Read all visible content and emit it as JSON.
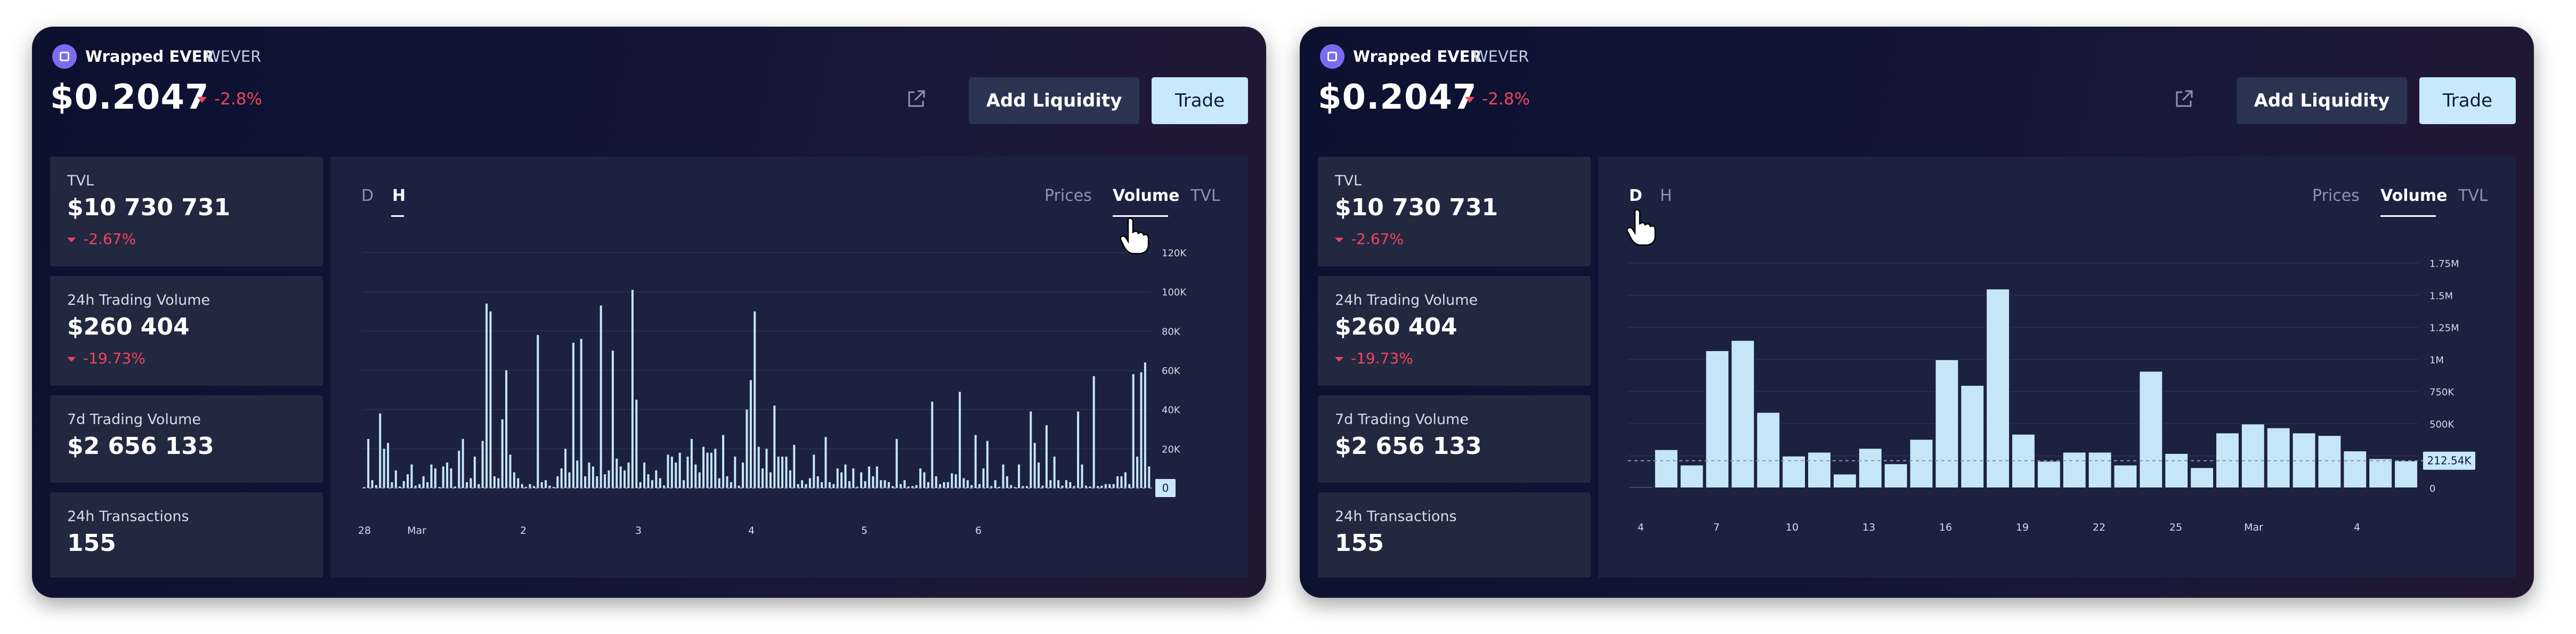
{
  "colors": {
    "panel_bg": "#0f1234",
    "card_bg": "#222840",
    "chart_bg": "#1c2140",
    "negative": "#f0435c",
    "bar_fill": "#c5e6f7",
    "trade_button": "#c8e8fb",
    "liquidity_button": "#2a3350"
  },
  "panels": [
    {
      "token": {
        "name": "Wrapped EVER",
        "symbol": "WEVER"
      },
      "price": "$0.2047",
      "price_change": "-2.8%",
      "buttons": {
        "add_liquidity": "Add Liquidity",
        "trade": "Trade"
      },
      "stats": [
        {
          "label": "TVL",
          "value": "$10 730 731",
          "change": "-2.67%"
        },
        {
          "label": "24h Trading Volume",
          "value": "$260 404",
          "change": "-19.73%"
        },
        {
          "label": "7d Trading Volume",
          "value": "$2 656 133",
          "change": ""
        },
        {
          "label": "24h Transactions",
          "value": "155",
          "change": ""
        }
      ],
      "period_tabs": [
        "D",
        "H"
      ],
      "active_period": "H",
      "metric_tabs": [
        "Prices",
        "Volume",
        "TVL"
      ],
      "active_metric": "Volume"
    },
    {
      "token": {
        "name": "Wrapped EVER",
        "symbol": "WEVER"
      },
      "price": "$0.2047",
      "price_change": "-2.8%",
      "buttons": {
        "add_liquidity": "Add Liquidity",
        "trade": "Trade"
      },
      "stats": [
        {
          "label": "TVL",
          "value": "$10 730 731",
          "change": "-2.67%"
        },
        {
          "label": "24h Trading Volume",
          "value": "$260 404",
          "change": "-19.73%"
        },
        {
          "label": "7d Trading Volume",
          "value": "$2 656 133",
          "change": ""
        },
        {
          "label": "24h Transactions",
          "value": "155",
          "change": ""
        }
      ],
      "period_tabs": [
        "D",
        "H"
      ],
      "active_period": "D",
      "metric_tabs": [
        "Prices",
        "Volume",
        "TVL"
      ],
      "active_metric": "Volume"
    }
  ],
  "chart_data": [
    {
      "type": "bar",
      "ylim": [
        0,
        120000
      ],
      "y_ticks": [
        0,
        20000,
        40000,
        60000,
        80000,
        100000,
        120000
      ],
      "y_tick_labels": [
        "0",
        "20K",
        "40K",
        "60K",
        "80K",
        "100K",
        "120K"
      ],
      "x_tick_labels": [
        "28",
        "Mar",
        "2",
        "3",
        "4",
        "5",
        "6"
      ],
      "current_value_label": "0",
      "current_value": 0,
      "values": [
        500,
        25000,
        4000,
        1500,
        38000,
        20000,
        23000,
        3000,
        9000,
        800,
        3500,
        7000,
        12000,
        1200,
        2000,
        6000,
        3000,
        12000,
        10000,
        500,
        11000,
        13000,
        10000,
        800,
        19000,
        25000,
        3000,
        5000,
        16000,
        2000,
        24000,
        94000,
        90000,
        6000,
        5000,
        35000,
        60000,
        17000,
        8000,
        5000,
        2000,
        600,
        2000,
        1000,
        78000,
        3000,
        4000,
        1200,
        500,
        6000,
        10000,
        20000,
        8000,
        74000,
        14000,
        76000,
        6000,
        13000,
        11000,
        6000,
        93000,
        7000,
        9000,
        70000,
        15000,
        11000,
        9000,
        13000,
        101000,
        45000,
        3000,
        13000,
        7000,
        4000,
        9000,
        5000,
        1300,
        17000,
        16000,
        13000,
        18000,
        4000,
        16000,
        25000,
        12000,
        8000,
        21000,
        18000,
        18000,
        20000,
        5000,
        27000,
        6000,
        3000,
        16000,
        1200,
        13000,
        40000,
        55000,
        90000,
        21000,
        10000,
        20000,
        8000,
        42000,
        16000,
        16000,
        16000,
        9000,
        22000,
        2000,
        4000,
        2000,
        5000,
        17000,
        6000,
        3000,
        26000,
        3000,
        2000,
        10000,
        8000,
        12000,
        3500,
        10000,
        700,
        8000,
        3500,
        11000,
        6000,
        11000,
        4000,
        4000,
        3000,
        1000,
        25000,
        2000,
        4000,
        800,
        1000,
        1500,
        10000,
        8000,
        3000,
        44000,
        6000,
        2000,
        3000,
        3000,
        7500,
        7000,
        49000,
        5000,
        4000,
        1500,
        27000,
        2000,
        10000,
        24000,
        1000,
        4000,
        600,
        12000,
        6000,
        1500,
        500,
        12000,
        1000,
        1000,
        39000,
        23000,
        13000,
        1200,
        32000,
        4000,
        16000,
        4000,
        1200,
        4000,
        3000,
        1000,
        39000,
        12000,
        1200,
        800,
        57000,
        1000,
        1200,
        2000,
        2000,
        2000,
        6000,
        6000,
        8000,
        2000,
        58000,
        16000,
        59000,
        64000,
        11000
      ]
    },
    {
      "type": "bar",
      "ylim": [
        0,
        1750000
      ],
      "y_ticks": [
        0,
        250000,
        500000,
        750000,
        1000000,
        1250000,
        1500000,
        1750000
      ],
      "y_tick_labels": [
        "0",
        "250K",
        "500K",
        "750K",
        "1M",
        "1.25M",
        "1.5M",
        "1.75M"
      ],
      "x_tick_labels": [
        "4",
        "7",
        "10",
        "13",
        "16",
        "19",
        "22",
        "25",
        "Mar",
        "4"
      ],
      "current_value_label": "212.54K",
      "current_value": 212540,
      "values": [
        10000,
        300000,
        180000,
        1070000,
        1150000,
        590000,
        250000,
        280000,
        110000,
        310000,
        190000,
        380000,
        1000000,
        800000,
        1550000,
        420000,
        210000,
        280000,
        280000,
        180000,
        910000,
        270000,
        160000,
        430000,
        500000,
        470000,
        430000,
        410000,
        290000,
        230000,
        212540
      ]
    }
  ]
}
